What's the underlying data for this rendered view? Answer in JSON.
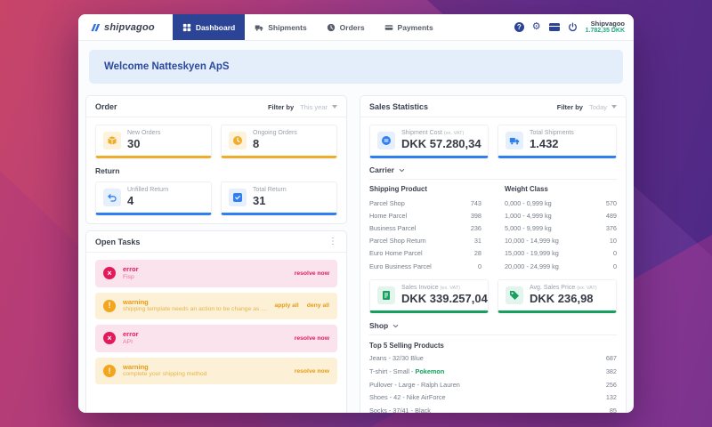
{
  "colors": {
    "brand_blue": "#2c4496",
    "accent_yellow": "#f0ad2d",
    "accent_blue": "#2f7ff0",
    "accent_green": "#17a05f",
    "error_red": "#e2195b",
    "warning_orange": "#f2a51d",
    "balance_green": "#1fa97c",
    "banner_blue": "#e4eefb"
  },
  "icons": {
    "help": "?",
    "gear": "⚙",
    "kebab": "⋮",
    "error_glyph": "×",
    "warning_glyph": "!"
  },
  "navbar": {
    "logo_text": "shipvagoo",
    "items": [
      {
        "label": "Dashboard"
      },
      {
        "label": "Shipments"
      },
      {
        "label": "Orders"
      },
      {
        "label": "Payments"
      }
    ],
    "account": {
      "name": "Shipvagoo",
      "balance": "1.782,35 DKK"
    }
  },
  "welcome": {
    "title": "Welcome Natteskyen ApS"
  },
  "order_section": {
    "title": "Order",
    "filter_label": "Filter by",
    "filter_value": "This year",
    "cards": [
      {
        "label": "New Orders",
        "value": "30"
      },
      {
        "label": "Ongoing Orders",
        "value": "8"
      }
    ]
  },
  "return_section": {
    "title": "Return",
    "cards": [
      {
        "label": "Unfilled Return",
        "value": "4"
      },
      {
        "label": "Total Return",
        "value": "31"
      }
    ]
  },
  "open_tasks": {
    "title": "Open Tasks",
    "tasks": [
      {
        "severity": "error",
        "title": "error",
        "description": "Fisp",
        "link1": "resolve now",
        "link2": ""
      },
      {
        "severity": "warning",
        "title": "warning",
        "description": "shipping template needs an action to be change as active template",
        "link1": "apply all",
        "link2": "deny all"
      },
      {
        "severity": "error",
        "title": "error",
        "description": "API",
        "link1": "resolve now",
        "link2": ""
      },
      {
        "severity": "warning",
        "title": "warning",
        "description": "complete your shipping method",
        "link1": "resolve now",
        "link2": ""
      }
    ]
  },
  "sales_statistics": {
    "title": "Sales Statistics",
    "filter_label": "Filter by",
    "filter_value": "Today",
    "shipment_cards": [
      {
        "label": "Shipment Cost",
        "suffix": "(ex. VAT)",
        "value": "DKK 57.280,34"
      },
      {
        "label": "Total Shipments",
        "suffix": "",
        "value": "1.432"
      }
    ],
    "carrier": {
      "title": "Carrier",
      "shipping_product": {
        "header": "Shipping Product",
        "rows": [
          [
            "Parcel Shop",
            "743"
          ],
          [
            "Home Parcel",
            "398"
          ],
          [
            "Business Parcel",
            "236"
          ],
          [
            "Parcel Shop Return",
            "31"
          ],
          [
            "Euro Home Parcel",
            "28"
          ],
          [
            "Euro Business Parcel",
            "0"
          ]
        ]
      },
      "weight_class": {
        "header": "Weight Class",
        "rows": [
          [
            "0,000 - 0,999 kg",
            "570"
          ],
          [
            "1,000 - 4,999 kg",
            "489"
          ],
          [
            "5,000 - 9,999 kg",
            "376"
          ],
          [
            "10,000 - 14,999 kg",
            "10"
          ],
          [
            "15,000 - 19,999 kg",
            "0"
          ],
          [
            "20,000 - 24,999 kg",
            "0"
          ]
        ]
      }
    },
    "sales_cards": [
      {
        "label": "Sales Invoice",
        "suffix": "(ex. VAT)",
        "value": "DKK 339.257,04"
      },
      {
        "label": "Avg. Sales Price",
        "suffix": "(ex. VAT)",
        "value": "DKK 236,98"
      }
    ],
    "shop": {
      "title": "Shop",
      "products_header": "Top 5 Selling Products",
      "products": [
        {
          "name": "Jeans - 32/30 Blue",
          "highlight": "",
          "value": "687"
        },
        {
          "name": "T-shirt - Small - ",
          "highlight": "Pokemon",
          "value": "382"
        },
        {
          "name": "Pullover - Large - Ralph Lauren",
          "highlight": "",
          "value": "256"
        },
        {
          "name": "Shoes - 42 - Nike AirForce",
          "highlight": "",
          "value": "132"
        },
        {
          "name": "Socks - 37/41 - Black",
          "highlight": "",
          "value": "85"
        }
      ]
    }
  }
}
